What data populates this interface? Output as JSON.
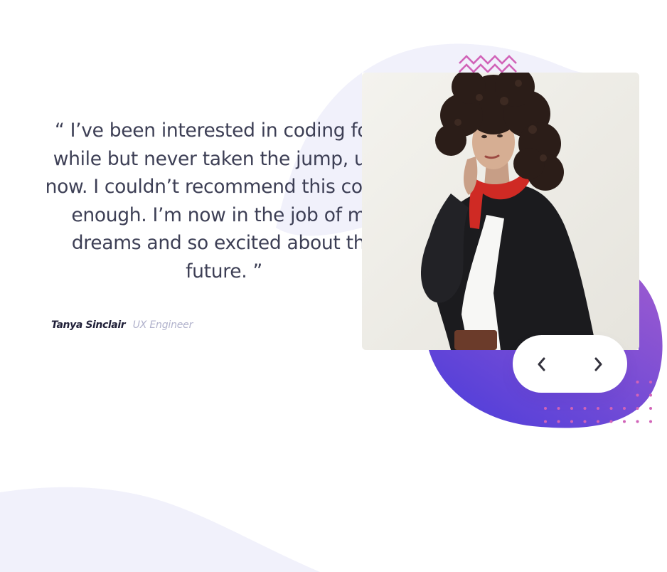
{
  "testimonial": {
    "quote": "“ I’ve been interested in coding for a while but never taken the jump, until now. I couldn’t recommend this course enough. I’m now in the job of my dreams and so excited about the future. ”",
    "author_name": "Tanya Sinclair",
    "author_role": "UX Engineer"
  },
  "photo": {
    "alt": "Tanya Sinclair"
  },
  "navigation": {
    "previous_icon": "chevron-left-icon",
    "next_icon": "chevron-right-icon"
  },
  "colors": {
    "text": "#3d3f55",
    "author": "#202038",
    "role": "#b1b2cc",
    "blob_light": "#f1f1fb",
    "blob_purple_start": "#4a3cdb",
    "blob_purple_end": "#9b5ad0",
    "accent_pink": "#d163b8"
  }
}
